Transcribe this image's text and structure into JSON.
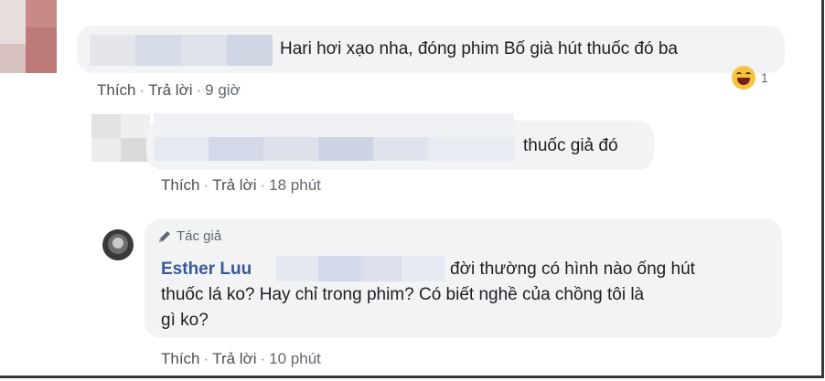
{
  "comment1": {
    "text": "Hari hơi xạo nha, đóng phim Bố già hút thuốc đó ba",
    "reaction_icon": "laughing-emoji-icon",
    "reaction_count": "1",
    "actions": {
      "like": "Thích",
      "reply": "Trả lời",
      "time": "9 giờ"
    }
  },
  "comment2": {
    "text": "thuốc giả đó",
    "actions": {
      "like": "Thích",
      "reply": "Trả lời",
      "time": "18 phút"
    }
  },
  "comment3": {
    "author_tag": "Tác giả",
    "author_name": "Esther Luu",
    "line1": "đời thường có hình nào ống hút",
    "line2": "thuốc lá ko? Hay chỉ trong phim? Có biết nghề của chồng tôi là",
    "line3": "gì ko?",
    "actions": {
      "like": "Thích",
      "reply": "Trả lời",
      "time": "10 phút"
    }
  },
  "colors": {
    "bubble_bg": "#f2f3f5",
    "name_link": "#385898",
    "meta_text": "#606770"
  }
}
